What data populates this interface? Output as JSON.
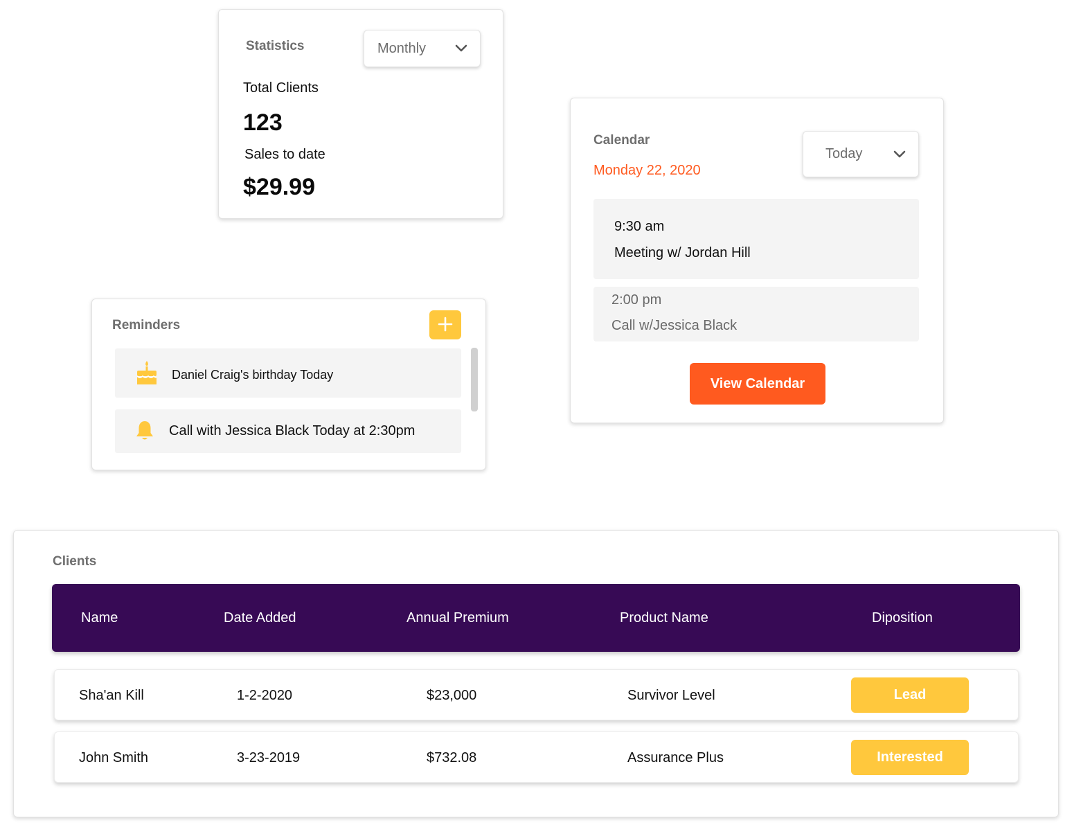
{
  "statistics": {
    "title": "Statistics",
    "period_select": "Monthly",
    "total_clients_label": "Total Clients",
    "total_clients_value": "123",
    "sales_label": "Sales to date",
    "sales_value": "$29.99"
  },
  "calendar": {
    "title": "Calendar",
    "date": "Monday 22, 2020",
    "range_select": "Today",
    "events": [
      {
        "time": "9:30 am",
        "title": "Meeting w/ Jordan Hill"
      },
      {
        "time": "2:00 pm",
        "title": "Call w/Jessica Black"
      }
    ],
    "view_button": "View Calendar"
  },
  "reminders": {
    "title": "Reminders",
    "items": [
      {
        "icon": "cake-icon",
        "text": "Daniel Craig's birthday Today"
      },
      {
        "icon": "bell-icon",
        "text": "Call with Jessica Black Today at 2:30pm"
      }
    ]
  },
  "clients": {
    "title": "Clients",
    "columns": [
      "Name",
      "Date Added",
      "Annual Premium",
      "Product Name",
      "Diposition"
    ],
    "rows": [
      {
        "name": "Sha'an Kill",
        "date_added": "1-2-2020",
        "annual_premium": "$23,000",
        "product": "Survivor Level",
        "disposition": "Lead"
      },
      {
        "name": "John Smith",
        "date_added": "3-23-2019",
        "annual_premium": "$732.08",
        "product": "Assurance Plus",
        "disposition": "Interested"
      }
    ]
  },
  "colors": {
    "accent_orange": "#ff5a1f",
    "accent_yellow": "#ffc83d",
    "header_purple": "#370a55"
  }
}
